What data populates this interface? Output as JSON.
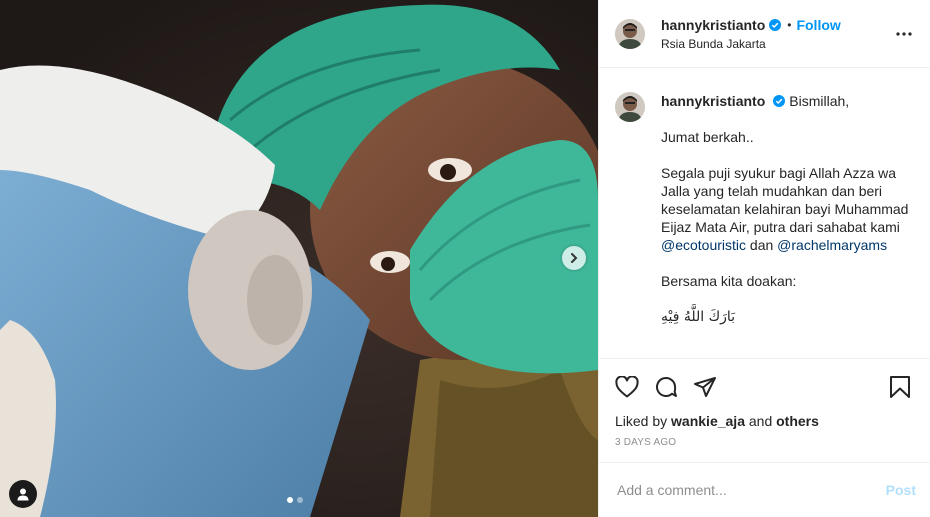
{
  "post": {
    "username": "hannykristianto",
    "follow_label": "Follow",
    "separator": "•",
    "location": "Rsia Bunda Jakarta",
    "caption": {
      "first_line": "Bismillah,",
      "line2": "Jumat berkah..",
      "para_a": "Segala puji syukur bagi Allah Azza wa Jalla yang telah mudahkan dan beri keselamatan kelahiran bayi Muhammad Eijaz Mata Air, putra dari sahabat kami ",
      "mention1": "@ecotouristic",
      "and_word": " dan ",
      "mention2": "@rachelmaryams",
      "line4": "Bersama kita doakan:",
      "line5": "بَارَكَ اللَّهُ فِيْهِ"
    },
    "liked_prefix": "Liked by ",
    "liked_user": "wankie_aja",
    "liked_and": " and ",
    "liked_others": "others",
    "timestamp": "3 DAYS AGO",
    "comment_placeholder": "Add a comment...",
    "post_label": "Post"
  },
  "carousel": {
    "current": 1,
    "total": 2
  },
  "icons": {
    "verified": "verified-badge-icon",
    "more": "more-options-icon",
    "like": "heart-icon",
    "comment": "comment-bubble-icon",
    "share": "paper-plane-icon",
    "save": "bookmark-icon",
    "next": "chevron-right-icon",
    "tags": "user-tag-icon"
  },
  "colors": {
    "link": "#0095f6",
    "mention": "#00376b",
    "border": "#efefef",
    "muted": "#8e8e8e"
  }
}
